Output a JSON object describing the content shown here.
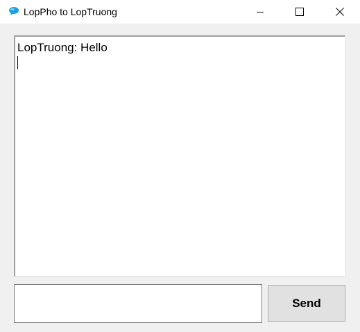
{
  "window": {
    "title": "LopPho to LopTruong",
    "icon": "chat-bubble-icon",
    "controls": {
      "minimize_icon": "minimize-icon",
      "maximize_icon": "maximize-icon",
      "close_icon": "close-icon"
    }
  },
  "chat": {
    "messages": [
      "LopTruong: Hello"
    ]
  },
  "composer": {
    "input_value": "",
    "send_label": "Send"
  },
  "colors": {
    "window_background": "#f0f0f0",
    "icon_accent": "#1ba1e2",
    "button_background": "#e1e1e1"
  }
}
